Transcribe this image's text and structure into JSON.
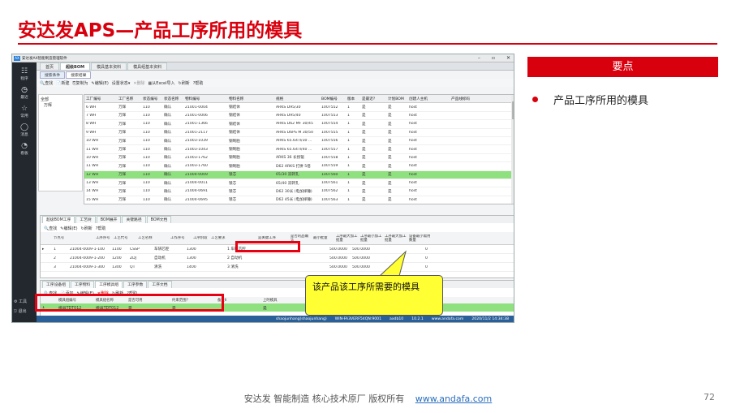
{
  "slide": {
    "title": "安达发APS—产品工序所用的模具",
    "panel_title": "要点",
    "bullet": "产品工序所用的模具",
    "footer_text": "安达发  智能制造 核心技术原厂  版权所有",
    "footer_link": "www.andafa.com",
    "page_number": "72",
    "callout": "该产品该工序所需要的模具"
  },
  "app": {
    "title": "安达发AX智能制造管理软件",
    "window_buttons": [
      "–",
      "▫",
      "✕"
    ],
    "sidebar": [
      {
        "icon": "☷",
        "label": "程序"
      },
      {
        "icon": "◷",
        "label": "最近"
      },
      {
        "icon": "☆",
        "label": "常用"
      },
      {
        "icon": "◯",
        "label": "消息"
      },
      {
        "icon": "◔",
        "label": "看板"
      }
    ],
    "sidebar_bottom": [
      {
        "icon": "⚙",
        "label": "工具"
      },
      {
        "icon": "⎋",
        "label": "退出"
      }
    ],
    "tabs": [
      "首页",
      "超级BOM",
      "模具基本资料",
      "模具组基本资料"
    ],
    "subtabs": [
      "搜索条件",
      "搜索结果"
    ],
    "toolbar": [
      "查找",
      "新建",
      "复制为",
      "编辑(E)",
      "设置状态",
      "删除",
      "从Excel导入",
      "刷新",
      "帮助"
    ],
    "tree": [
      "全部",
      "万辉"
    ],
    "grid_headers": [
      "工厂编号",
      "工厂名称",
      "状态编号",
      "状态名称",
      "物料编号",
      "物料名称",
      "规格",
      "BOM编号",
      "版本",
      "是最近?",
      "计划BOM",
      "创建人主机",
      "产品线标码"
    ],
    "rows": [
      [
        "6 WH",
        "万辉",
        "110",
        "确认",
        "21001-0004",
        "钢结体",
        "ARKS D95/30",
        "1007552",
        "1",
        "是",
        "是",
        "host",
        ""
      ],
      [
        "7 WH",
        "万辉",
        "110",
        "确认",
        "21001-0006",
        "钢结体",
        "ARKS D95/40",
        "1007553",
        "1",
        "是",
        "是",
        "host",
        ""
      ],
      [
        "8 WH",
        "万辉",
        "110",
        "确认",
        "21001-1366",
        "钢结体",
        "ARKS D62 MF 30/45",
        "1007554",
        "1",
        "是",
        "是",
        "host",
        ""
      ],
      [
        "9 WH",
        "万辉",
        "110",
        "确认",
        "21001-2117",
        "钢结体",
        "ARKS D6PS M 30/50",
        "1007555",
        "1",
        "是",
        "是",
        "host",
        ""
      ],
      [
        "10 WH",
        "万辉",
        "110",
        "确认",
        "21003-1039",
        "钢制胎",
        "ARKS 65.64TI/30 ...",
        "1007556",
        "1",
        "是",
        "是",
        "host",
        ""
      ],
      [
        "11 WH",
        "万辉",
        "110",
        "确认",
        "21003-1043",
        "钢制胎",
        "ARKS 65.64TI/40 ...",
        "1007557",
        "1",
        "是",
        "是",
        "host",
        ""
      ],
      [
        "10 WH",
        "万辉",
        "110",
        "确认",
        "21003-1762",
        "钢制胎",
        "ARKS 36 长拐锯",
        "1007558",
        "1",
        "是",
        "是",
        "host",
        ""
      ],
      [
        "11 WH",
        "万辉",
        "110",
        "确认",
        "21003-1760",
        "钢制胎",
        "D62 ARKS 打拼 5倍",
        "1007559",
        "1",
        "是",
        "是",
        "host",
        ""
      ],
      [
        "12 WH",
        "万辉",
        "110",
        "确认",
        "21004-0009",
        "锁芯",
        "65/30 双转孔",
        "1007560",
        "1",
        "是",
        "是",
        "host",
        ""
      ],
      [
        "13 WH",
        "万辉",
        "110",
        "确认",
        "21004-0011",
        "锁芯",
        "65/40 双转孔",
        "1007561",
        "1",
        "是",
        "是",
        "host",
        ""
      ],
      [
        "14 WH",
        "万辉",
        "110",
        "确认",
        "21004-0691",
        "锁芯",
        "D62 30长 (电加择锤)",
        "1007562",
        "1",
        "是",
        "是",
        "host",
        ""
      ],
      [
        "15 WH",
        "万辉",
        "110",
        "确认",
        "21004-0695",
        "锁芯",
        "D62 45长 (电加择锤)",
        "1007563",
        "1",
        "是",
        "是",
        "host",
        ""
      ]
    ],
    "lower_tabs": [
      "超级BOM工序",
      "工艺树",
      "BOM展开",
      "关键路径",
      "BOM文档"
    ],
    "lower_toolbar": [
      "查找",
      "编辑(E)",
      "刷新",
      "帮助"
    ],
    "lower_headers": [
      "节点号",
      "工序序号",
      "工艺代号",
      "工艺名称",
      "工作序号",
      "工序阶段",
      "工艺要求",
      "是关键工序",
      "是否的品确认",
      "最小批量",
      "工序最大加工批量",
      "工序最小加工批量",
      "工序最大加工批量",
      "设备最小需用数量"
    ],
    "lower_rows": [
      [
        "1",
        "21004-0009-1-100",
        "1100",
        "CSSP",
        "车研芯腔",
        "1300",
        "",
        "1 车研芯腔",
        "",
        "",
        "500.0000",
        "500.0000",
        "",
        "",
        "0"
      ],
      [
        "2",
        "21004-0009-1-200",
        "1200",
        "ZDJ",
        "自动机",
        "1300",
        "",
        "2 自动机",
        "",
        "",
        "500.0000",
        "500.0000",
        "",
        "",
        "0"
      ],
      [
        "3",
        "21004-0009-1-300",
        "1300",
        "QT",
        "清洗",
        "1400",
        "",
        "3 清洗",
        "",
        "",
        "500.0000",
        "500.0000",
        "",
        "",
        "0"
      ]
    ],
    "bottom_tabs": [
      "工序设备组",
      "工序物料",
      "工序模具组",
      "工序参数",
      "工序文档"
    ],
    "bottom_toolbar": [
      "查找",
      "添加",
      "编辑(E)",
      "删除",
      "刷新",
      "帮助"
    ],
    "bottom_headers": [
      "模具组编号",
      "模具组名称",
      "是否可用",
      "约束范围？",
      "备注II",
      "上时模具"
    ],
    "bottom_row": [
      "1",
      "模具TDT012",
      "模具TDT012",
      "是",
      "是",
      "",
      "是"
    ],
    "status": [
      "shaojunhang(shaojunhang)",
      "WIN-FA3VERF54QN:9001",
      "axdb10",
      "10.2.1",
      "www.andafa.com",
      "2020/11/2 14:34:38"
    ]
  }
}
